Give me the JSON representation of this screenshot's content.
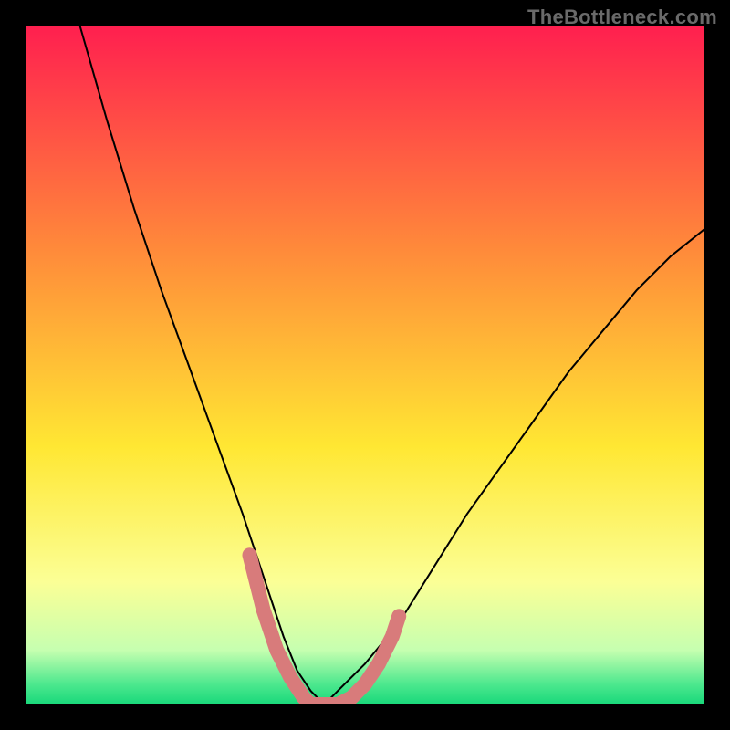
{
  "watermark": "TheBottleneck.com",
  "chart_data": {
    "type": "line",
    "title": "",
    "xlabel": "",
    "ylabel": "",
    "xlim": [
      0,
      100
    ],
    "ylim": [
      0,
      100
    ],
    "grid": false,
    "legend": false,
    "series": [
      {
        "name": "bottleneck-curve",
        "x": [
          8,
          12,
          16,
          20,
          24,
          28,
          32,
          34,
          36,
          38,
          40,
          42,
          44,
          46,
          50,
          55,
          60,
          65,
          70,
          75,
          80,
          85,
          90,
          95,
          100
        ],
        "y": [
          100,
          86,
          73,
          61,
          50,
          39,
          28,
          22,
          16,
          10,
          5,
          2,
          0,
          2,
          6,
          12,
          20,
          28,
          35,
          42,
          49,
          55,
          61,
          66,
          70
        ],
        "color": "#000000"
      }
    ],
    "markers": [
      {
        "name": "curve-highlight-left",
        "x": [
          33,
          35,
          37,
          39,
          41
        ],
        "y": [
          22,
          14,
          8,
          4,
          1
        ],
        "color": "#d87b7b"
      },
      {
        "name": "curve-highlight-bottom",
        "x": [
          42,
          44,
          46,
          48,
          50
        ],
        "y": [
          0,
          0,
          0,
          1,
          3
        ],
        "color": "#d87b7b"
      },
      {
        "name": "curve-highlight-right",
        "x": [
          52,
          54,
          55
        ],
        "y": [
          6,
          10,
          13
        ],
        "color": "#d87b7b"
      }
    ],
    "background_gradient": {
      "stops": [
        {
          "offset": 0.0,
          "color": "#ff1f4f"
        },
        {
          "offset": 0.33,
          "color": "#ff8a3a"
        },
        {
          "offset": 0.62,
          "color": "#ffe733"
        },
        {
          "offset": 0.82,
          "color": "#fbff96"
        },
        {
          "offset": 0.92,
          "color": "#c6ffb0"
        },
        {
          "offset": 0.97,
          "color": "#4de88e"
        },
        {
          "offset": 1.0,
          "color": "#18d87a"
        }
      ]
    }
  }
}
